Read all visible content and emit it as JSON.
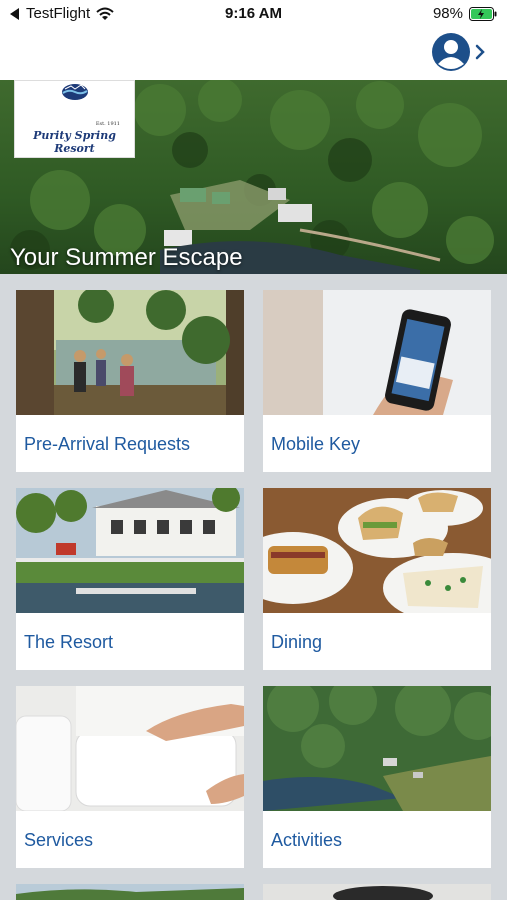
{
  "status_bar": {
    "back_app": "TestFlight",
    "time": "9:16 AM",
    "battery": "98%"
  },
  "header": {
    "profile_icon": "user-circle-icon",
    "chevron_icon": "chevron-right-icon"
  },
  "hero": {
    "logo_text": "Purity Spring Resort",
    "logo_est": "Est. 1911",
    "caption": "Your Summer Escape"
  },
  "tiles": [
    {
      "label": "Pre-Arrival Requests"
    },
    {
      "label": "Mobile Key"
    },
    {
      "label": "The Resort"
    },
    {
      "label": "Dining"
    },
    {
      "label": "Services"
    },
    {
      "label": "Activities"
    }
  ],
  "colors": {
    "accent": "#1f5aa0",
    "grid_bg": "#d4d8dc",
    "battery_green": "#34c759",
    "logo_blue": "#1d3a78"
  }
}
